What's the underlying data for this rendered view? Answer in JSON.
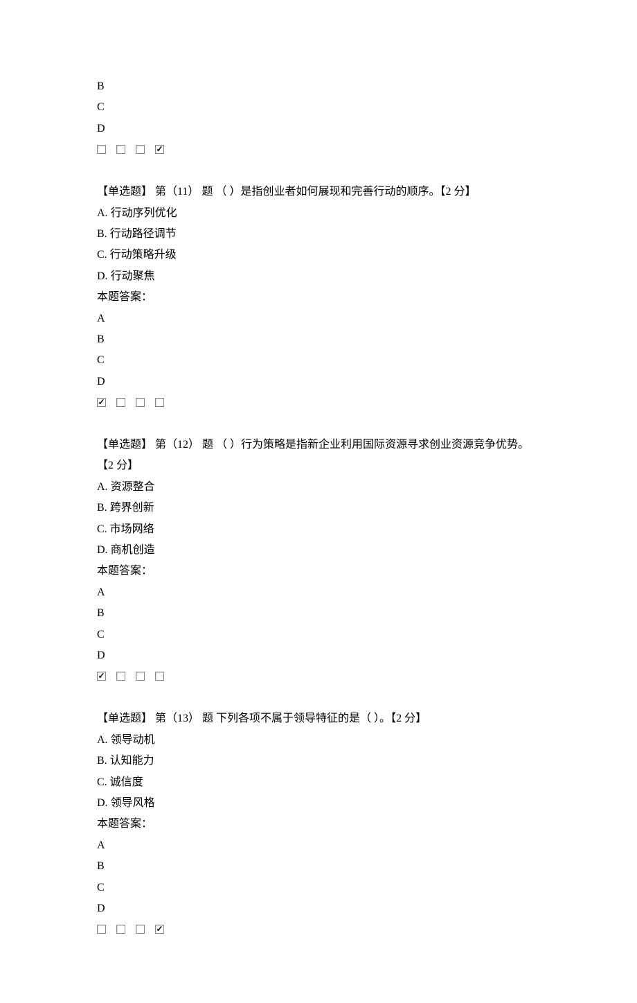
{
  "partial": {
    "letters": [
      "B",
      "C",
      "D"
    ],
    "checked": [
      false,
      false,
      false,
      true
    ]
  },
  "questions": [
    {
      "type_label": "【单选题】",
      "number_prefix": "第（11）",
      "number_suffix": "题",
      "text": "（ ）是指创业者如何展现和完善行动的顺序。",
      "points": "【2 分】",
      "options": [
        {
          "label": "A.",
          "text": "行动序列优化"
        },
        {
          "label": "B.",
          "text": "行动路径调节"
        },
        {
          "label": "C.",
          "text": "行动策略升级"
        },
        {
          "label": "D.",
          "text": "行动聚焦"
        }
      ],
      "answer_label": "本题答案：",
      "letters": [
        "A",
        "B",
        "C",
        "D"
      ],
      "checked": [
        true,
        false,
        false,
        false
      ]
    },
    {
      "type_label": "【单选题】",
      "number_prefix": "第（12）",
      "number_suffix": "题",
      "text": "（ ）行为策略是指新企业利用国际资源寻求创业资源竞争优势。",
      "points": "【2 分】",
      "options": [
        {
          "label": "A.",
          "text": "资源整合"
        },
        {
          "label": "B.",
          "text": "跨界创新"
        },
        {
          "label": "C.",
          "text": "市场网络"
        },
        {
          "label": "D.",
          "text": "商机创造"
        }
      ],
      "answer_label": "本题答案：",
      "letters": [
        "A",
        "B",
        "C",
        "D"
      ],
      "checked": [
        true,
        false,
        false,
        false
      ]
    },
    {
      "type_label": "【单选题】",
      "number_prefix": "第（13）",
      "number_suffix": "题",
      "text": "下列各项不属于领导特征的是（ ）。",
      "points": "【2 分】",
      "options": [
        {
          "label": "A.",
          "text": "领导动机"
        },
        {
          "label": "B.",
          "text": "认知能力"
        },
        {
          "label": "C.",
          "text": "诚信度"
        },
        {
          "label": "D.",
          "text": "领导风格"
        }
      ],
      "answer_label": "本题答案：",
      "letters": [
        "A",
        "B",
        "C",
        "D"
      ],
      "checked": [
        false,
        false,
        false,
        true
      ]
    }
  ]
}
